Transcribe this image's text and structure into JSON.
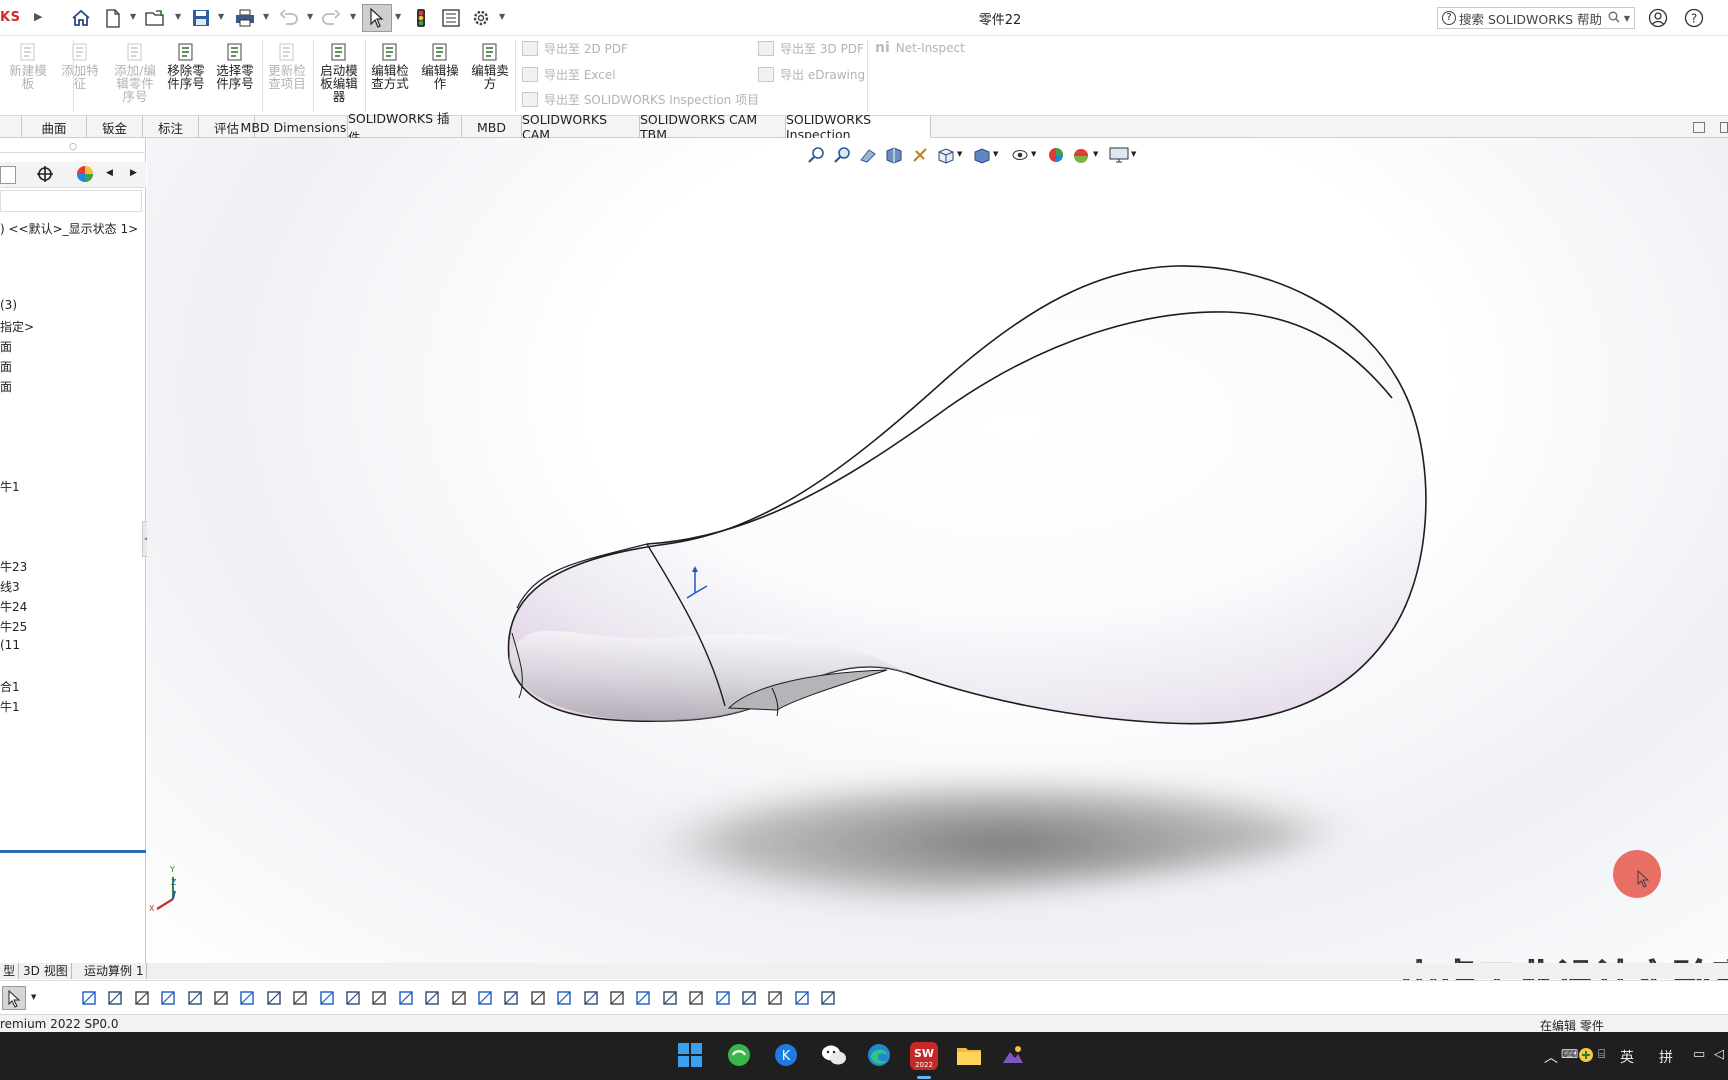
{
  "app": {
    "brand": "KS",
    "document_title": "零件22",
    "search_placeholder": "搜索 SOLIDWORKS 帮助"
  },
  "ribbon": {
    "buttons": [
      {
        "label_lines": [
          "新建模",
          "板"
        ],
        "disabled": true
      },
      {
        "label_lines": [
          "添加特",
          "征"
        ],
        "disabled": true
      },
      {
        "label_lines": [
          "添加/编",
          "辑零件",
          "序号"
        ],
        "disabled": true
      },
      {
        "label_lines": [
          "移除零",
          "件序号"
        ],
        "disabled": false
      },
      {
        "label_lines": [
          "选择零",
          "件序号"
        ],
        "disabled": false
      },
      {
        "label_lines": [
          "更新检",
          "查项目"
        ],
        "disabled": true
      },
      {
        "label_lines": [
          "启动模",
          "板编辑",
          "器"
        ],
        "disabled": false
      },
      {
        "label_lines": [
          "编辑检",
          "查方式"
        ],
        "disabled": false
      },
      {
        "label_lines": [
          "编辑操",
          "作"
        ],
        "disabled": false
      },
      {
        "label_lines": [
          "编辑卖",
          "方"
        ],
        "disabled": false
      }
    ],
    "export_items": {
      "export_2d_pdf": "导出至 2D PDF",
      "export_excel": "导出至 Excel",
      "export_inspection": "导出至 SOLIDWORKS Inspection 项目",
      "export_3d_pdf": "导出至 3D PDF",
      "export_edrawing": "导出 eDrawing",
      "net_inspect": "Net-Inspect"
    }
  },
  "tabs": [
    "曲面",
    "钣金",
    "标注",
    "评估",
    "MBD Dimensions",
    "SOLIDWORKS 插件",
    "MBD",
    "SOLIDWORKS CAM",
    "SOLIDWORKS CAM TBM",
    "SOLIDWORKS Inspection"
  ],
  "active_tab": "SOLIDWORKS Inspection",
  "feature_tree": {
    "config_line": ") <<默认>_显示状态 1>",
    "items": [
      "(3)",
      "指定>",
      "面",
      "面",
      "面",
      "牛1",
      "牛23",
      "线3",
      "牛24",
      "牛25",
      "(11",
      "合1",
      "牛1"
    ]
  },
  "bottom_tabs": [
    "型",
    "3D 视图",
    "运动算例 1"
  ],
  "status": {
    "version": "remium 2022 SP0.0",
    "state": "在编辑 零件"
  },
  "taskbar": {
    "lang1": "英",
    "lang2": "拼"
  },
  "watermark": "小虎工业设计实验室",
  "axis_labels": {
    "x": "X",
    "y": "Y",
    "z": "Z"
  }
}
